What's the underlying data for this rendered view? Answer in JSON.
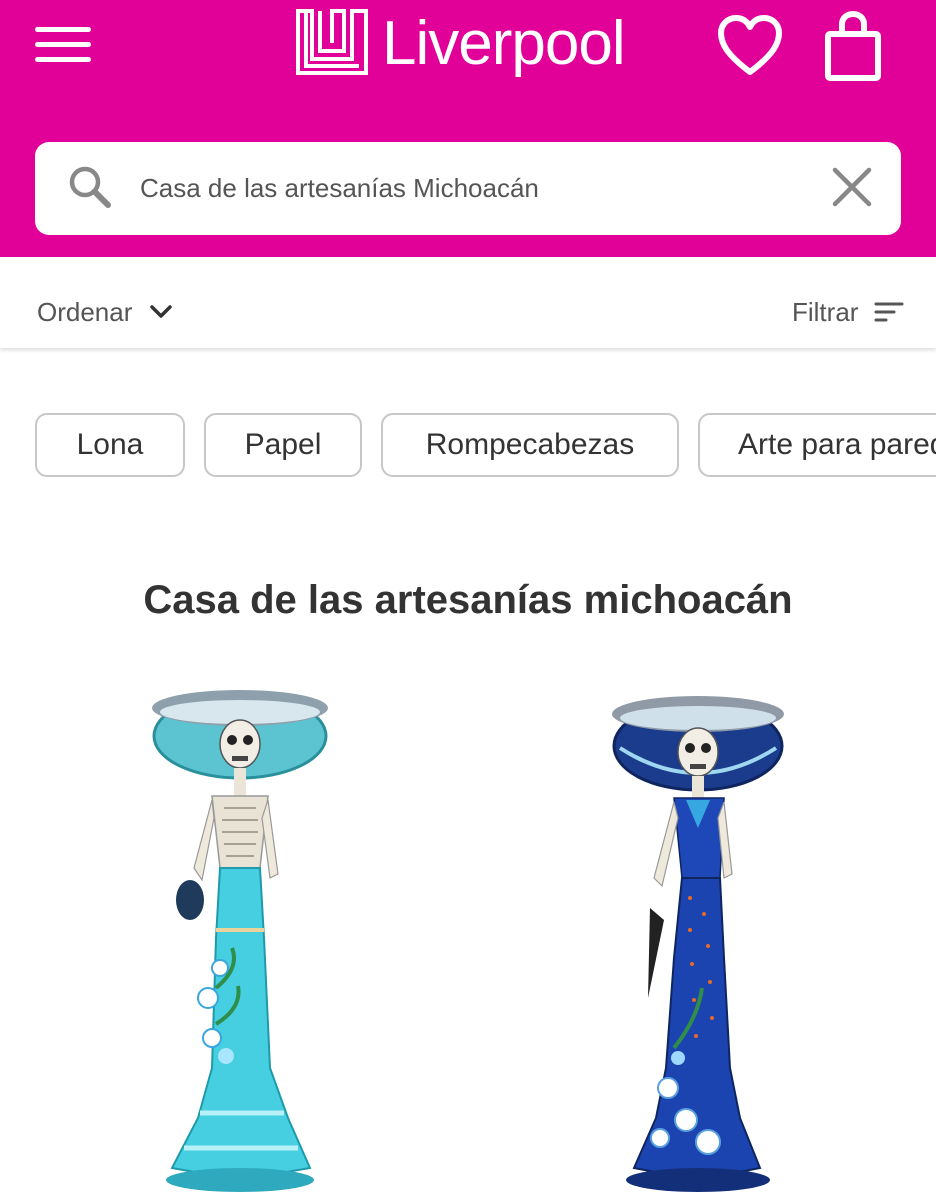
{
  "header": {
    "brand": "Liverpool",
    "accent_color": "#e10098",
    "menu_icon": "hamburger-menu-icon",
    "wishlist_icon": "heart-icon",
    "cart_icon": "shopping-bag-icon"
  },
  "search": {
    "value": "Casa de las artesanías Michoacán",
    "search_icon": "search-icon",
    "clear_icon": "close-icon"
  },
  "toolbar": {
    "sort_label": "Ordenar",
    "filter_label": "Filtrar"
  },
  "chips": [
    {
      "label": "Lona"
    },
    {
      "label": "Papel"
    },
    {
      "label": "Rompecabezas"
    },
    {
      "label": "Arte para pared"
    }
  ],
  "page_title": "Casa de las artesanías michoacán",
  "products": [
    {
      "image": "catrina-figurine-turquoise"
    },
    {
      "image": "catrina-figurine-blue"
    }
  ]
}
